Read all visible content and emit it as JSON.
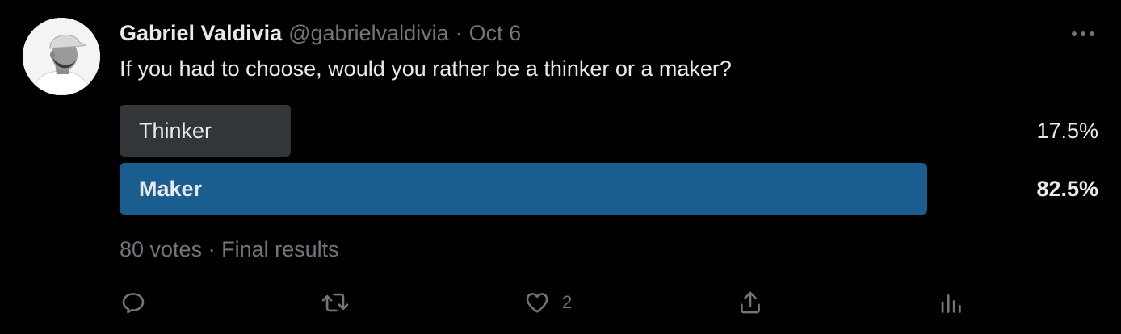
{
  "colors": {
    "background": "#000000",
    "text_primary": "#e7e9ea",
    "text_secondary": "#71767b",
    "poll_bar_default": "#333639",
    "poll_bar_winner": "#1a5e8f"
  },
  "tweet": {
    "author": {
      "display_name": "Gabriel Valdivia",
      "handle": "@gabrielvaldivia",
      "avatar_icon": "user-photo-avatar"
    },
    "separator": "·",
    "date": "Oct 6",
    "more_icon": "more-horizontal-icon",
    "text": "If you had to choose, would you rather be a thinker or a maker?"
  },
  "poll": {
    "options": [
      {
        "label": "Thinker",
        "percent_text": "17.5%",
        "percent": 17.5,
        "winner": false
      },
      {
        "label": "Maker",
        "percent_text": "82.5%",
        "percent": 82.5,
        "winner": true
      }
    ],
    "votes": "80 votes",
    "separator": "·",
    "status": "Final results"
  },
  "actions": {
    "reply": {
      "icon": "reply-icon",
      "count": ""
    },
    "retweet": {
      "icon": "retweet-icon",
      "count": ""
    },
    "like": {
      "icon": "heart-icon",
      "count": "2"
    },
    "share": {
      "icon": "share-icon",
      "count": ""
    },
    "analytics": {
      "icon": "analytics-icon",
      "count": ""
    }
  }
}
